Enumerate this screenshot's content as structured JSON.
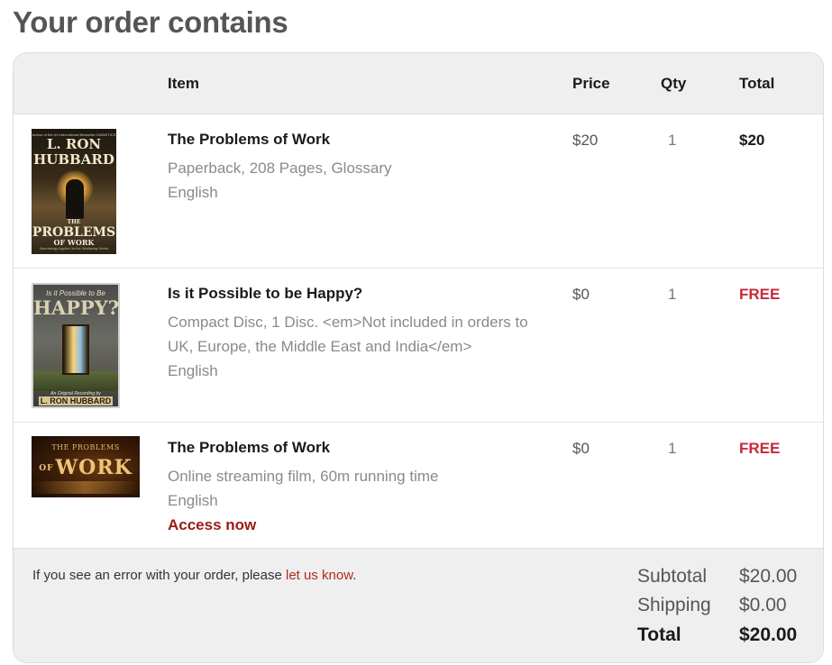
{
  "page": {
    "title": "Your order contains"
  },
  "table": {
    "columns": {
      "item": "Item",
      "price": "Price",
      "qty": "Qty",
      "total": "Total"
    },
    "rows": [
      {
        "title": "The Problems of Work",
        "description": "Paperback, 208 Pages, Glossary",
        "language": "English",
        "price": "$20",
        "qty": "1",
        "total": "$20",
        "thumbnail": {
          "top_note": "Author of the #1 International Bestseller DIANETICS",
          "author": "L. RON HUBBARD",
          "title_line1": "THE",
          "title_line2": "PROBLEMS",
          "title_line3": "OF WORK",
          "subtitle": "Scientology Applied to the Workaday World"
        }
      },
      {
        "title": "Is it Possible to be Happy?",
        "description": "Compact Disc, 1 Disc. <em>Not included in orders to UK, Europe, the Middle East and India</em>",
        "language": "English",
        "price": "$0",
        "qty": "1",
        "total": "FREE",
        "thumbnail": {
          "question": "Is it Possible to Be",
          "headline": "HAPPY?",
          "recording": "An Original Recording by",
          "author": "L. RON HUBBARD"
        }
      },
      {
        "title": "The Problems of Work",
        "description": "Online streaming film, 60m running time",
        "language": "English",
        "access_label": "Access now",
        "price": "$0",
        "qty": "1",
        "total": "FREE",
        "thumbnail": {
          "line1": "THE PROBLEMS",
          "line2": "OF",
          "line3": "WORK"
        }
      }
    ]
  },
  "footer": {
    "note_prefix": "If you see an error with your order, please ",
    "note_link": "let us know",
    "note_suffix": ".",
    "subtotal_label": "Subtotal",
    "subtotal_value": "$20.00",
    "shipping_label": "Shipping",
    "shipping_value": "$0.00",
    "total_label": "Total",
    "total_value": "$20.00"
  },
  "colors": {
    "heading": "#555555",
    "free": "#c8283a",
    "link": "#9b1c12",
    "header_bg": "#efefef"
  }
}
